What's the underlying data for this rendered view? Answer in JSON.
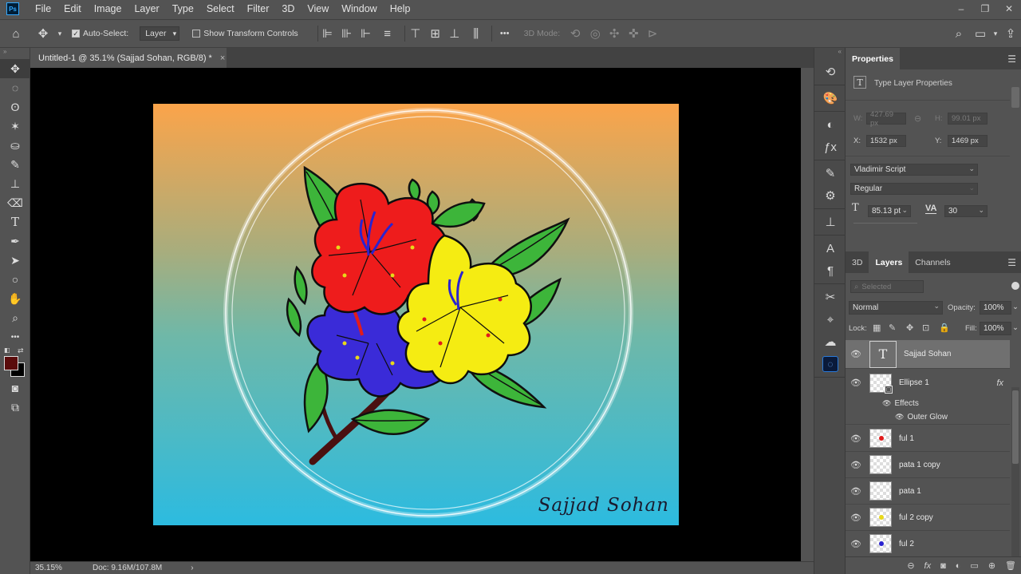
{
  "app": {
    "logo": "Ps"
  },
  "menu": [
    "File",
    "Edit",
    "Image",
    "Layer",
    "Type",
    "Select",
    "Filter",
    "3D",
    "View",
    "Window",
    "Help"
  ],
  "window_controls": {
    "minimize": "–",
    "restore": "❐",
    "close": "✕"
  },
  "options_bar": {
    "auto_select_label": "Auto-Select:",
    "auto_select_checked": true,
    "auto_select_target": "Layer",
    "show_transform_label": "Show Transform Controls",
    "more": "•••",
    "mode_3d_label": "3D Mode:"
  },
  "document": {
    "tab_title": "Untitled-1 @ 35.1% (Sajjad Sohan, RGB/8) *",
    "close": "×",
    "signature": "Sajjad Sohan",
    "colors": {
      "gradient_top": "#fba44a",
      "gradient_bottom": "#2cbbe0",
      "red_flower": "#ee1c1c",
      "yellow_flower": "#f5ec12",
      "blue_flower": "#3a2bd8",
      "leaf": "#3db53a"
    }
  },
  "status": {
    "zoom": "35.15%",
    "doc": "Doc: 9.16M/107.8M",
    "arrow": "›"
  },
  "properties": {
    "tab": "Properties",
    "subtitle": "Type Layer Properties",
    "w_label": "W:",
    "w_value": "427.69 px",
    "h_label": "H:",
    "h_value": "99.01 px",
    "x_label": "X:",
    "x_value": "1532 px",
    "y_label": "Y:",
    "y_value": "1469 px",
    "font_family": "Vladimir Script",
    "font_style": "Regular",
    "font_size": "85.13 pt",
    "tracking": "30"
  },
  "layers_panel": {
    "tabs": [
      "3D",
      "Layers",
      "Channels"
    ],
    "active_tab": "Layers",
    "filter_placeholder": "Selected",
    "blend_mode": "Normal",
    "opacity_label": "Opacity:",
    "opacity": "100%",
    "lock_label": "Lock:",
    "fill_label": "Fill:",
    "fill": "100%",
    "layers": [
      {
        "name": "Sajjad Sohan",
        "type": "text",
        "selected": true
      },
      {
        "name": "Ellipse 1",
        "type": "shape",
        "fx": "fx"
      },
      {
        "name": "ful 1",
        "type": "pixel",
        "dot": "#e21b1b"
      },
      {
        "name": "pata 1 copy",
        "type": "pixel",
        "dot": ""
      },
      {
        "name": "pata 1",
        "type": "pixel",
        "dot": ""
      },
      {
        "name": "ful 2 copy",
        "type": "pixel",
        "dot": "#e8d81a"
      },
      {
        "name": "ful 2",
        "type": "pixel",
        "dot": "#2a23d0"
      }
    ],
    "effects_label": "Effects",
    "outer_glow_label": "Outer Glow"
  }
}
